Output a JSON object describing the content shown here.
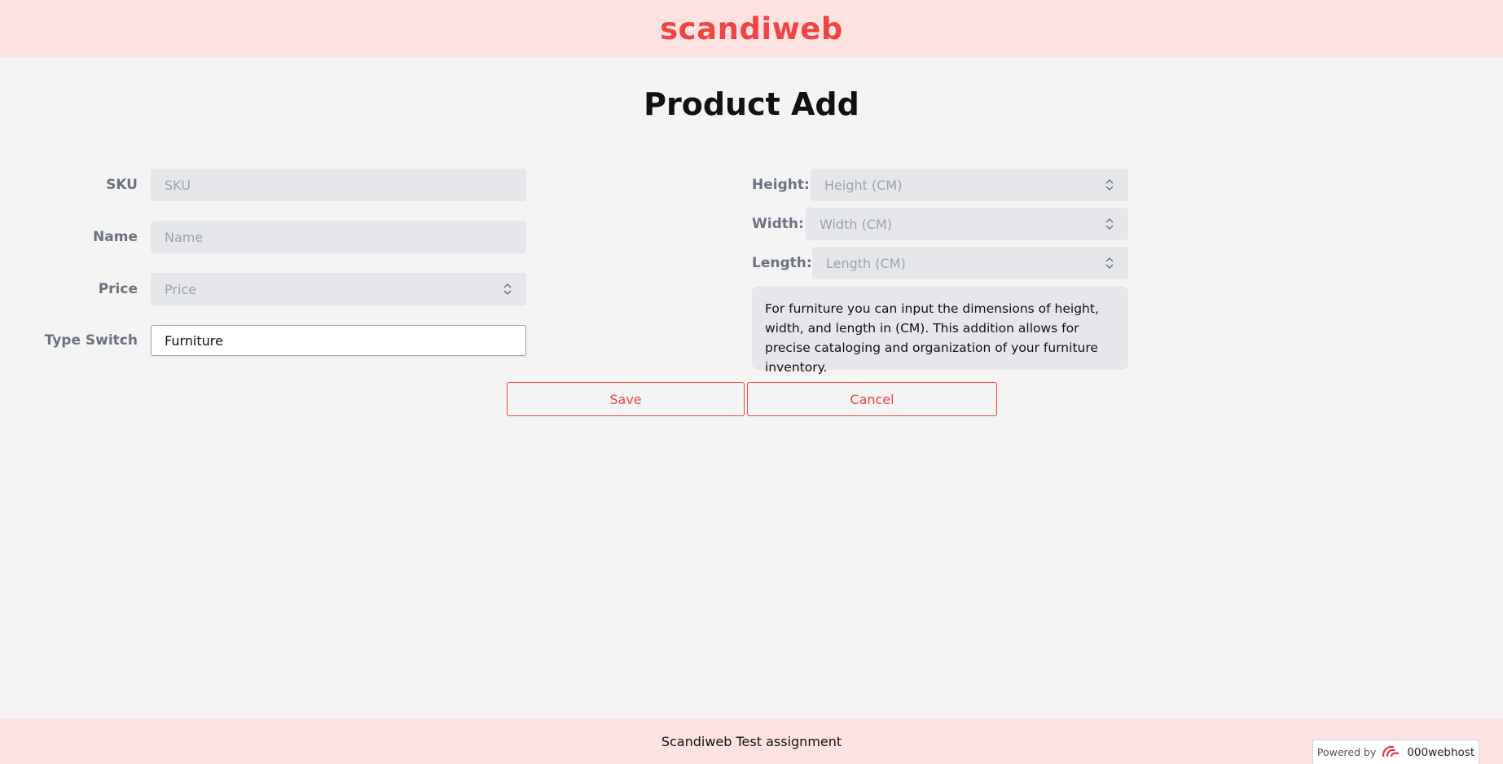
{
  "header": {
    "brand": "scandiweb"
  },
  "page": {
    "title": "Product Add"
  },
  "form": {
    "sku": {
      "label": "SKU",
      "placeholder": "SKU",
      "value": ""
    },
    "name": {
      "label": "Name",
      "placeholder": "Name",
      "value": ""
    },
    "price": {
      "label": "Price",
      "placeholder": "Price",
      "value": ""
    },
    "type_switch": {
      "label": "Type Switch",
      "selected": "Furniture"
    },
    "height": {
      "label": "Height:",
      "placeholder": "Height (CM)"
    },
    "width": {
      "label": "Width:",
      "placeholder": "Width (CM)"
    },
    "length": {
      "label": "Length:",
      "placeholder": "Length (CM)"
    },
    "info": "For furniture you can input the dimensions of height, width, and length in (CM). This addition allows for precise cataloging and organization of your furniture inventory."
  },
  "actions": {
    "save_label": "Save",
    "cancel_label": "Cancel"
  },
  "footer": {
    "text": "Scandiweb Test assignment"
  },
  "badge": {
    "powered_by": "Powered by",
    "host": "000webhost",
    "icon": "000webhost-logo-icon"
  },
  "colors": {
    "accent": "#ef4444",
    "header_bg": "#fee2e2",
    "field_bg": "#e5e7eb",
    "page_bg": "#f4f4f4"
  }
}
